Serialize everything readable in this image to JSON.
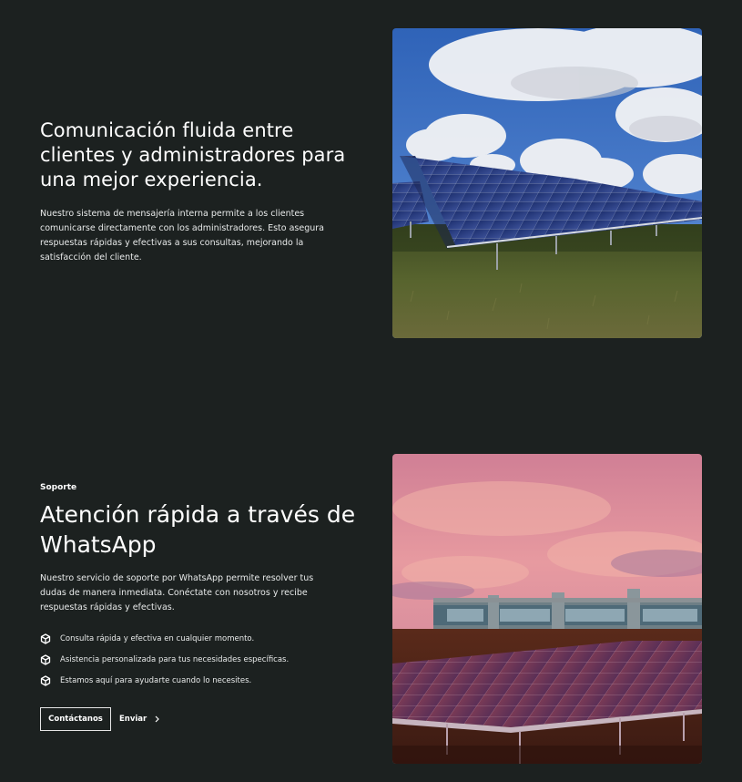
{
  "section_messaging": {
    "title": "Comunicación fluida entre clientes y administradores para una mejor experiencia.",
    "body": "Nuestro sistema de mensajería interna permite a los clientes comunicarse directamente con los administradores. Esto asegura respuestas rápidas y efectivas a sus consultas, mejorando la satisfacción del cliente.",
    "image_icon": "solar-field-photo"
  },
  "section_support": {
    "tagline": "Soporte",
    "title": "Atención rápida a través de WhatsApp",
    "body": "Nuestro servicio de soporte por WhatsApp permite resolver tus dudas de manera inmediata. Conéctate con nosotros y recibe respuestas rápidas y efectivas.",
    "features": [
      {
        "icon": "cube-icon",
        "text": "Consulta rápida y efectiva en cualquier momento."
      },
      {
        "icon": "cube-icon",
        "text": "Asistencia personalizada para tus necesidades específicas."
      },
      {
        "icon": "cube-icon",
        "text": "Estamos aquí para ayudarte cuando lo necesites."
      }
    ],
    "primary_button": "Contáctanos",
    "secondary_button": "Enviar",
    "image_icon": "solar-plant-sunset-photo"
  },
  "colors": {
    "background": "#1c2120",
    "text": "#ffffff",
    "button_border": "#e6e6e6"
  }
}
